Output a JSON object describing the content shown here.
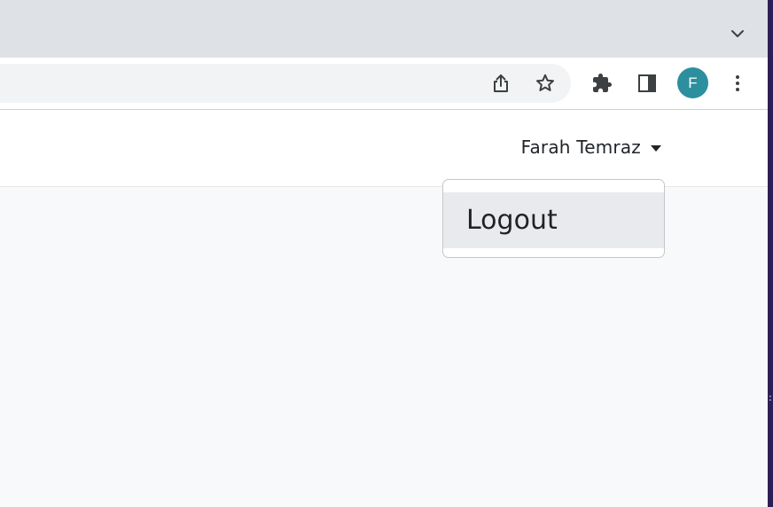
{
  "browser": {
    "tab_search_icon": "chevron-down-icon",
    "toolbar": {
      "icons": [
        "share-icon",
        "bookmark-star-icon",
        "extensions-puzzle-icon",
        "side-panel-icon",
        "more-vertical-icon"
      ],
      "profile_initial": "F",
      "profile_color": "#2b8f9e"
    }
  },
  "navbar": {
    "user_name": "Farah Temraz"
  },
  "dropdown": {
    "items": [
      {
        "label": "Logout"
      }
    ]
  },
  "colors": {
    "tabstrip_bg": "#dee1e6",
    "page_bg": "#f8f9fa",
    "dropdown_item_bg": "#e9eaed"
  }
}
